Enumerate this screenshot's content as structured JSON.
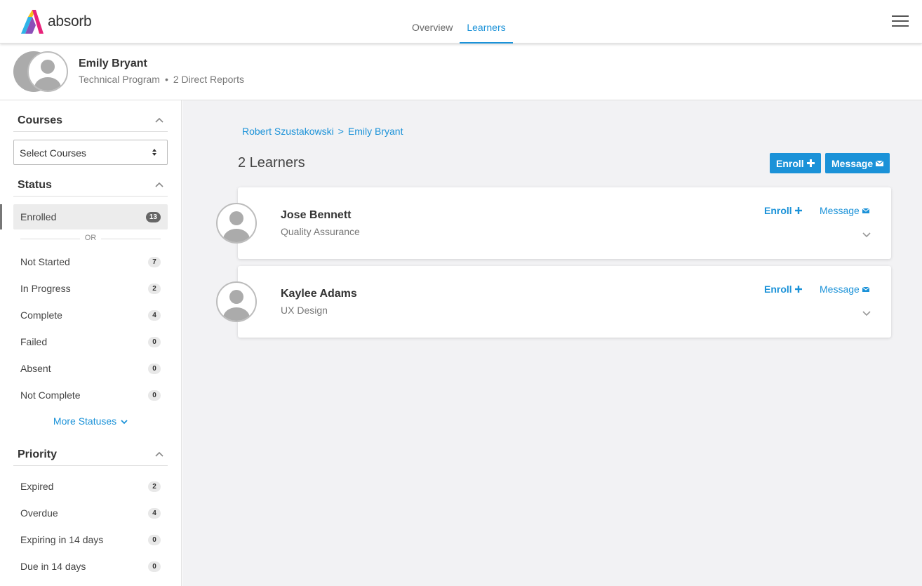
{
  "app": {
    "logo_text": "absorb",
    "tabs": [
      {
        "label": "Overview",
        "active": false
      },
      {
        "label": "Learners",
        "active": true
      }
    ]
  },
  "profile": {
    "name": "Emily Bryant",
    "program": "Technical Program",
    "reports": "2 Direct Reports"
  },
  "sidebar": {
    "courses": {
      "title": "Courses",
      "select_value": "Select Courses"
    },
    "status": {
      "title": "Status",
      "enrolled": {
        "label": "Enrolled",
        "count": "13"
      },
      "or_text": "OR",
      "items": [
        {
          "label": "Not Started",
          "count": "7"
        },
        {
          "label": "In Progress",
          "count": "2"
        },
        {
          "label": "Complete",
          "count": "4"
        },
        {
          "label": "Failed",
          "count": "0"
        },
        {
          "label": "Absent",
          "count": "0"
        },
        {
          "label": "Not Complete",
          "count": "0"
        }
      ],
      "more_label": "More Statuses"
    },
    "priority": {
      "title": "Priority",
      "items": [
        {
          "label": "Expired",
          "count": "2"
        },
        {
          "label": "Overdue",
          "count": "4"
        },
        {
          "label": "Expiring in 14 days",
          "count": "0"
        },
        {
          "label": "Due in 14 days",
          "count": "0"
        }
      ]
    }
  },
  "main": {
    "breadcrumb": [
      "Robert Szustakowski",
      "Emily Bryant"
    ],
    "breadcrumb_separator": ">",
    "learners_title": "2 Learners",
    "enroll_label": "Enroll",
    "message_label": "Message",
    "learners": [
      {
        "name": "Jose Bennett",
        "department": "Quality Assurance"
      },
      {
        "name": "Kaylee Adams",
        "department": "UX Design"
      }
    ]
  },
  "colors": {
    "accent": "#1b92d8",
    "main_background": "#f2f2f4",
    "badge_selected": "#666666"
  },
  "icons": [
    "menu-icon",
    "user-avatar-icon",
    "chevron-up-icon",
    "chevron-down-icon",
    "sort-arrows-icon",
    "plus-icon",
    "envelope-icon"
  ]
}
